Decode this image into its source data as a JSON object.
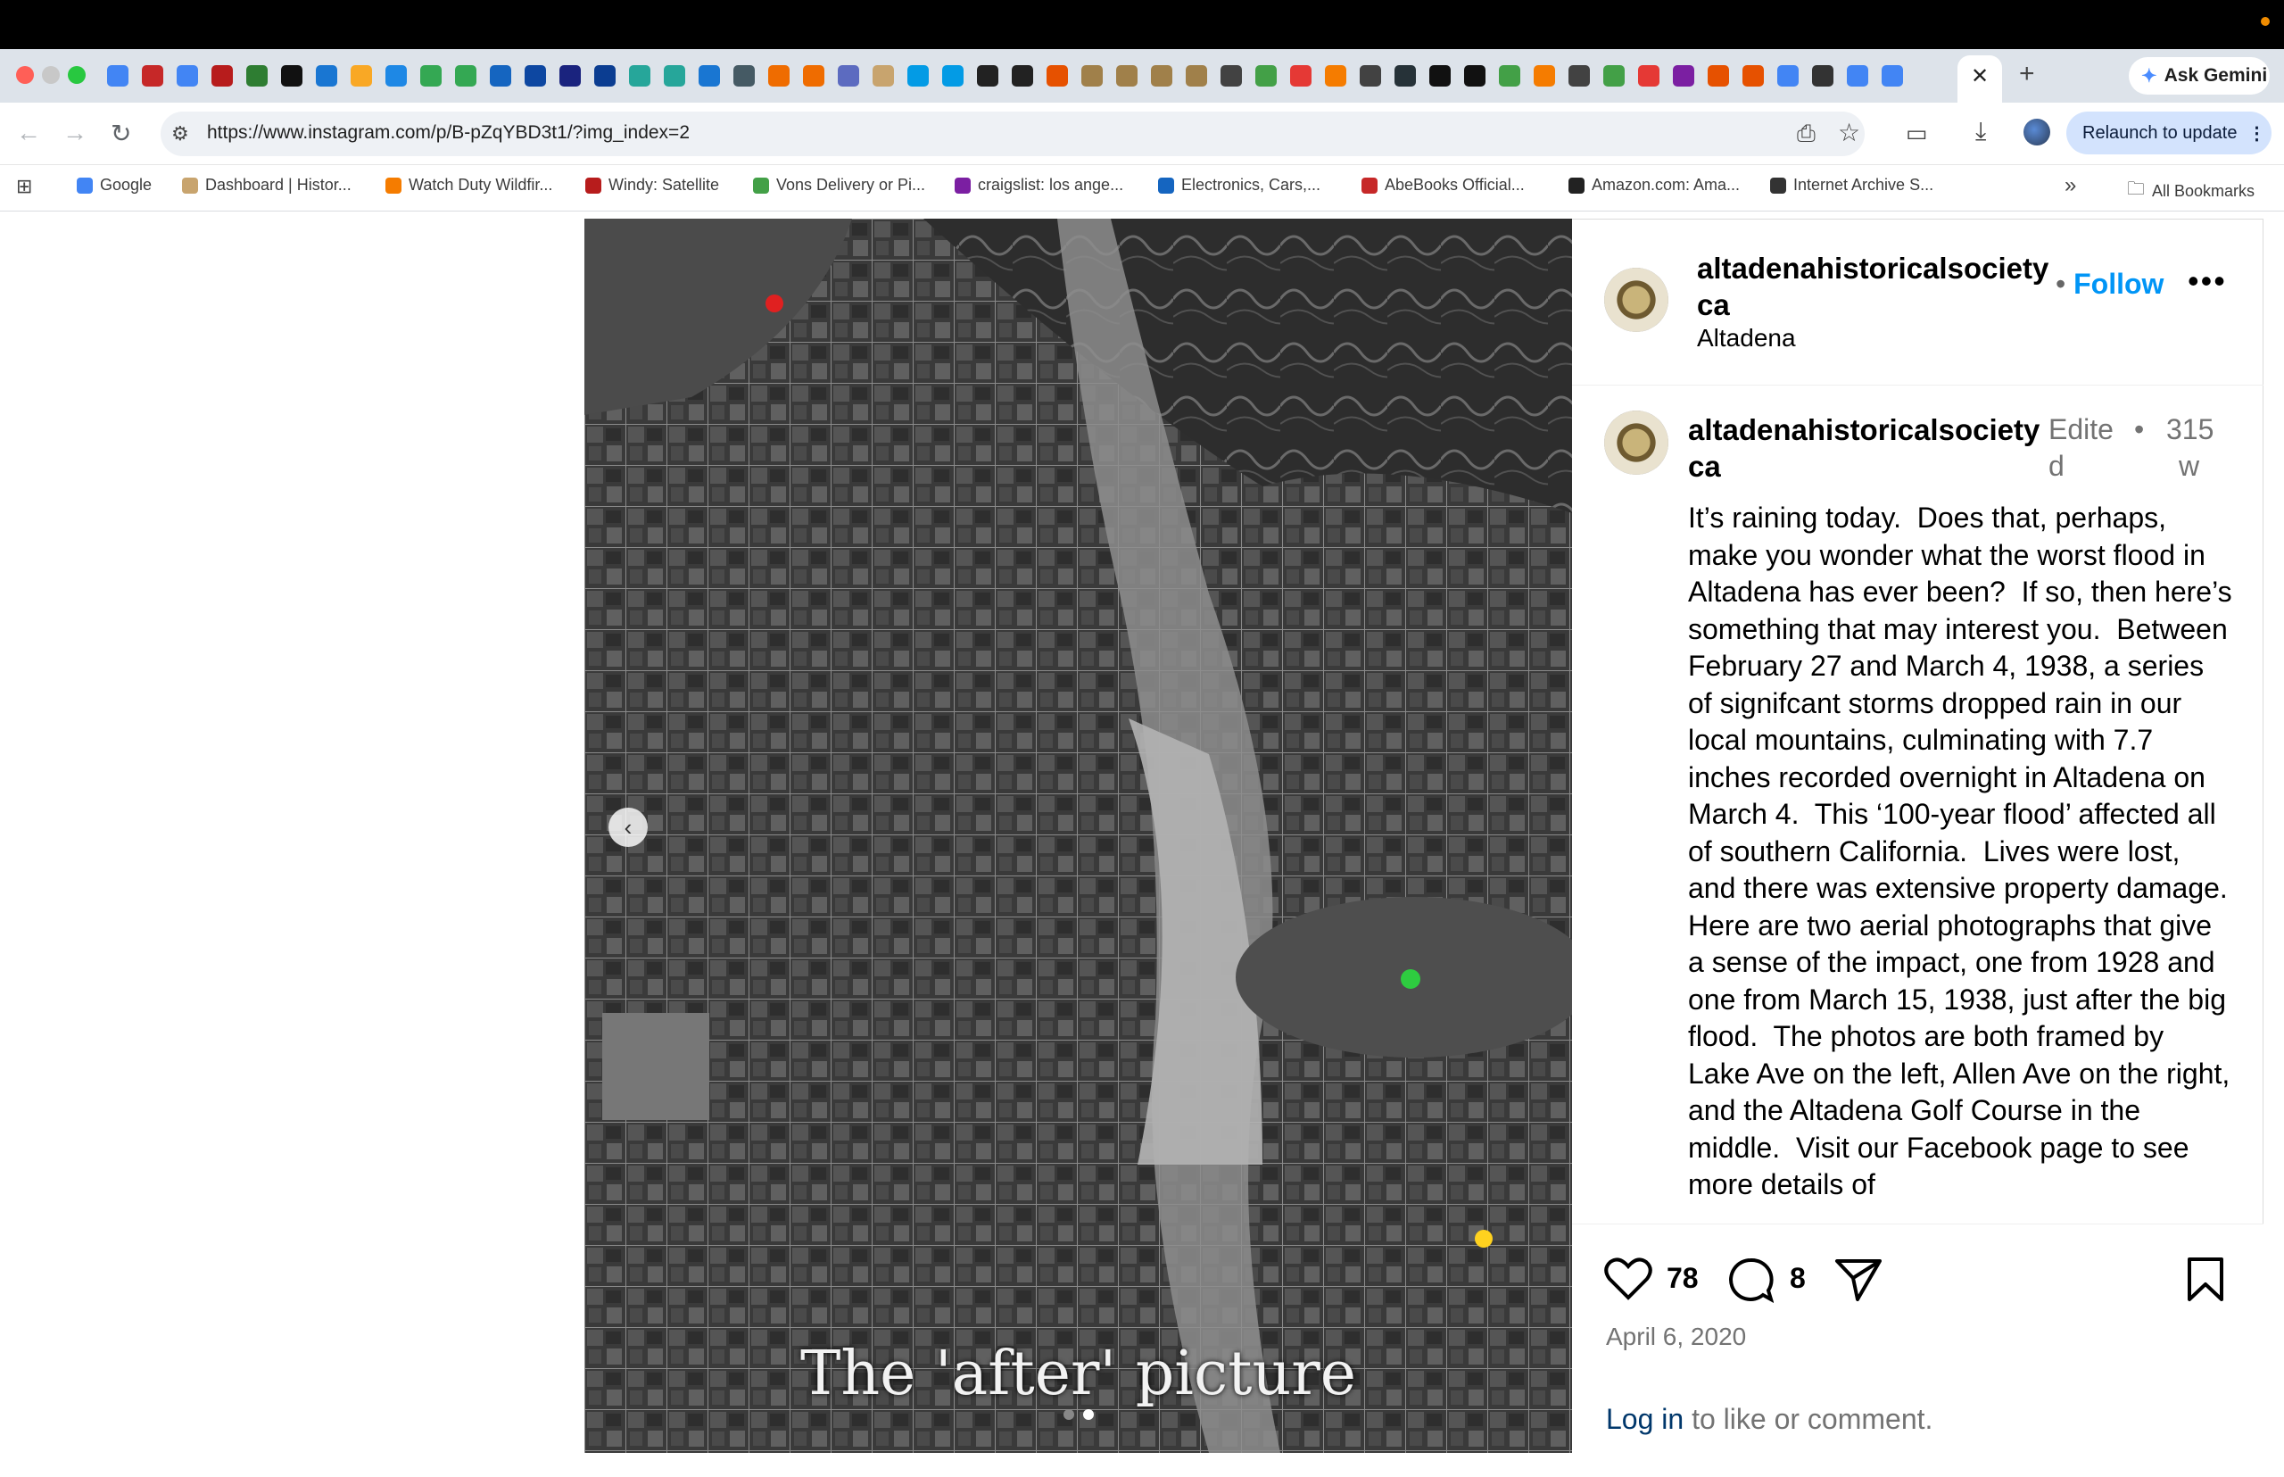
{
  "browser": {
    "tabs_count_note": "",
    "gemini_label": "Ask Gemini",
    "url": "https://www.instagram.com/p/B-pZqYBD3t1/?img_index=2",
    "relaunch_label": "Relaunch to update",
    "bookmarks": [
      {
        "label": "Google",
        "color": "#4285f4"
      },
      {
        "label": "Dashboard | Histor...",
        "color": "#c8a46e"
      },
      {
        "label": "Watch Duty Wildfir...",
        "color": "#f57c00"
      },
      {
        "label": "Windy: Satellite",
        "color": "#b71c1c"
      },
      {
        "label": "Vons Delivery or Pi...",
        "color": "#43a047"
      },
      {
        "label": "craigslist: los ange...",
        "color": "#7b1fa2"
      },
      {
        "label": "Electronics, Cars,...",
        "color": "#1565c0"
      },
      {
        "label": "AbeBooks Official...",
        "color": "#c62828"
      },
      {
        "label": "Amazon.com: Ama...",
        "color": "#222222"
      },
      {
        "label": "Internet Archive S...",
        "color": "#333333"
      }
    ],
    "all_bookmarks_label": "All Bookmarks"
  },
  "post": {
    "image_caption": "The 'after' picture",
    "account": "altadenahistoricalsociety ca",
    "account_line1": "altadenahistoricalsociety",
    "account_line2": "ca",
    "follow_label": "Follow",
    "location": "Altadena",
    "edited_label_1": "Edite",
    "edited_label_2": "d",
    "age_1": "315",
    "age_2": "w",
    "caption": "It’s raining today.  Does that, perhaps, make you wonder what the worst flood in Altadena has ever been?  If so, then here’s something that may interest you.  Between February 27 and March 4, 1938, a series of signifcant storms dropped rain in our local mountains, culminating with 7.7 inches recorded overnight in Altadena on March 4.  This ‘100-year flood’ affected all of southern California.  Lives were lost, and there was extensive property damage.\nHere are two aerial photographs that give a sense of the impact, one from 1928 and one from March 15, 1938, just after the big flood.  The photos are both framed by Lake Ave on the left, Allen Ave on the right, and the Altadena Golf Course in the middle.  Visit our Facebook page to see more details of",
    "likes": "78",
    "comments": "8",
    "date": "April 6, 2020",
    "login_link": "Log in",
    "login_rest": " to like or comment.",
    "image_index": 2,
    "image_total": 2
  }
}
